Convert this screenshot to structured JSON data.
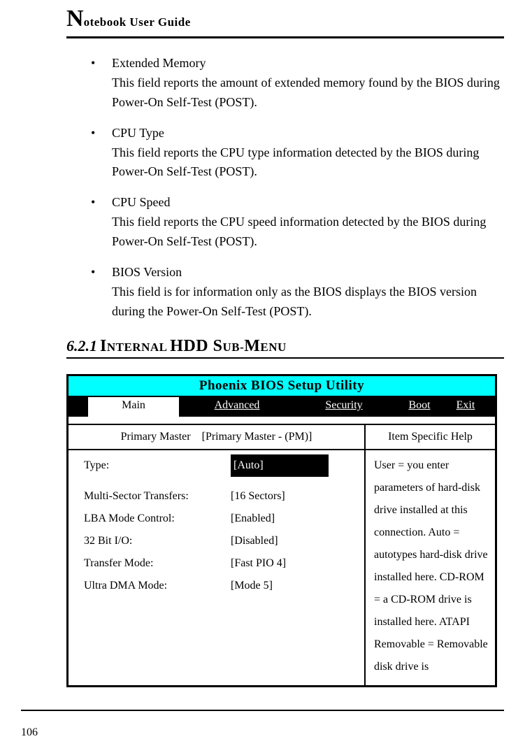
{
  "header": {
    "big": "N",
    "rest": "otebook User Guide"
  },
  "fields": [
    {
      "title": "Extended Memory",
      "desc": "This field reports the amount of extended memory found by the BIOS during Power-On Self-Test (POST)."
    },
    {
      "title": "CPU Type",
      "desc": "This field reports the CPU type information detected by the BIOS during Power-On Self-Test (POST)."
    },
    {
      "title": "CPU Speed",
      "desc": "This field reports the CPU speed information detected by the BIOS during Power-On Self-Test (POST)."
    },
    {
      "title": "BIOS Version",
      "desc": "This field is for information only as the BIOS displays the BIOS version during the Power-On Self-Test (POST)."
    }
  ],
  "section": {
    "num": "6.2.1",
    "title_parts": [
      "I",
      "NTERNAL ",
      "HDD S",
      "UB-",
      "M",
      "ENU"
    ]
  },
  "bios": {
    "title": "Phoenix BIOS Setup Utility",
    "tabs": {
      "main": "Main",
      "advanced": "Advanced",
      "security": "Security",
      "boot": "Boot",
      "exit": "Exit"
    },
    "sub_left_1": "Primary Master",
    "sub_left_2": "[Primary Master - (PM)]",
    "sub_right": "Item Specific Help",
    "rows": [
      {
        "label": "Type:",
        "value": "[Auto]",
        "selected": true
      },
      {
        "label": "Multi-Sector Transfers:",
        "value": "[16 Sectors]"
      },
      {
        "label": "LBA Mode Control:",
        "value": "[Enabled]"
      },
      {
        "label": "32 Bit I/O:",
        "value": "[Disabled]"
      },
      {
        "label": "Transfer Mode:",
        "value": "[Fast PIO 4]"
      },
      {
        "label": "Ultra DMA Mode:",
        "value": "[Mode 5]"
      }
    ],
    "help": "User = you enter parameters of hard-disk drive installed at this connection.\nAuto = autotypes hard-disk drive installed here.\nCD-ROM = a CD-ROM drive is installed here.\nATAPI Removable = Removable disk drive is"
  },
  "page_number": "106"
}
